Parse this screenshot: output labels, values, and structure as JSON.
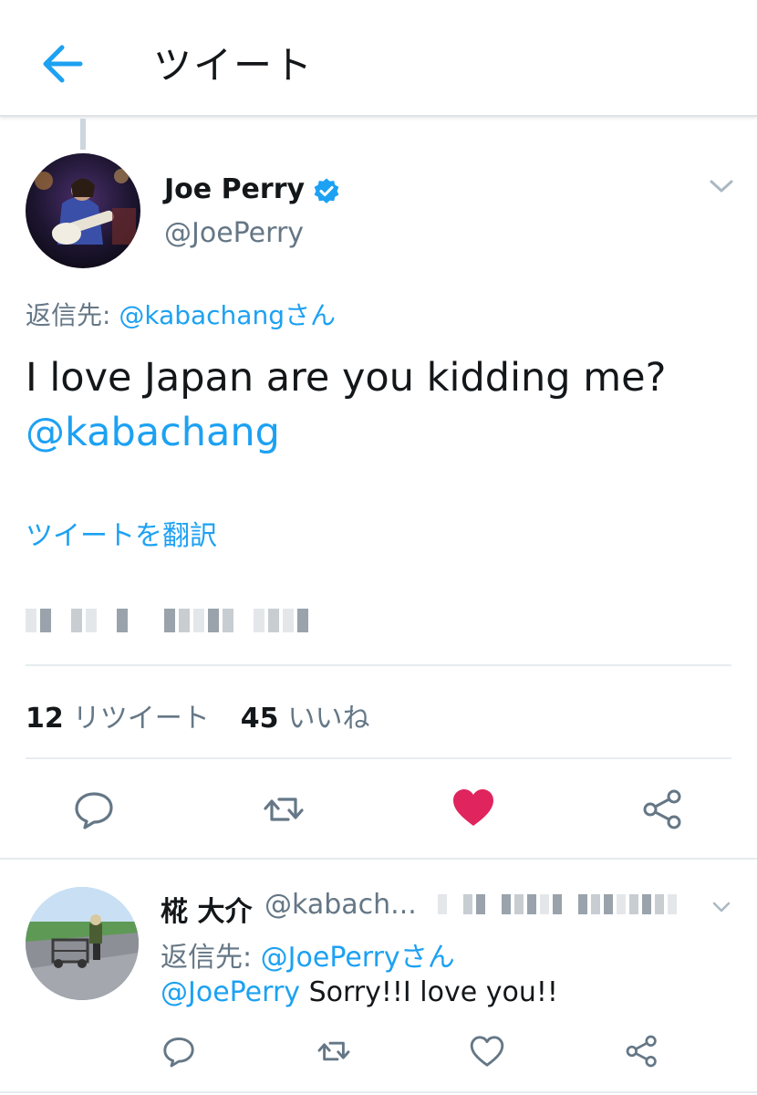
{
  "header": {
    "title": "ツイート",
    "back_icon": "arrow-left-icon"
  },
  "tweet": {
    "author_name": "Joe Perry",
    "author_handle": "@JoePerry",
    "verified": true,
    "reply_to_prefix": "返信先: ",
    "reply_to_mention": "@kabachangさん",
    "text": "I love Japan are you kidding me?",
    "text_mention": "@kabachang",
    "translate_label": "ツイートを翻訳",
    "stats": {
      "retweets_count": "12",
      "retweets_label": "リツイート",
      "likes_count": "45",
      "likes_label": "いいね"
    },
    "liked": true
  },
  "reply": {
    "author_name": "椛 大介",
    "author_handle": "@kabach...",
    "reply_to_prefix": "返信先: ",
    "reply_to_mention": "@JoePerryさん",
    "text_mention": "@JoePerry",
    "text": " Sorry!!I love you!!"
  },
  "colors": {
    "accent": "#1da1f2",
    "like": "#e0245e",
    "secondary_text": "#657786",
    "primary_text": "#14171a"
  }
}
